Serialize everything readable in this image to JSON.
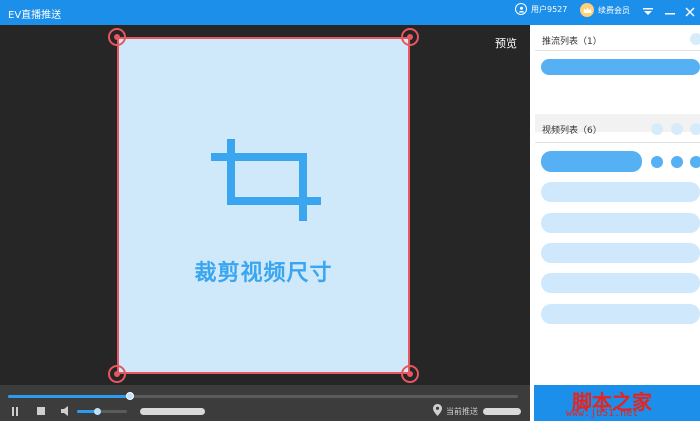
{
  "window": {
    "title": "EV直播推送",
    "user_label": "用户9527",
    "vip_label": "续费会员"
  },
  "preview": {
    "label": "预览",
    "crop_text": "裁剪视频尺寸"
  },
  "player": {
    "progress_value": 0.24,
    "volume_value": 0.4,
    "push_location_label": "当前推送"
  },
  "sidebar": {
    "push_list_title": "推流列表（1）",
    "video_list_title": "视频列表（6）"
  },
  "watermark": {
    "brand": "脚本之家",
    "url": "www.jb51.net"
  },
  "colors": {
    "titlebar": "#1b8fe9",
    "accent": "#2c9cf0",
    "crop_border": "#e8575f",
    "crop_fill": "#cfe9fb"
  }
}
